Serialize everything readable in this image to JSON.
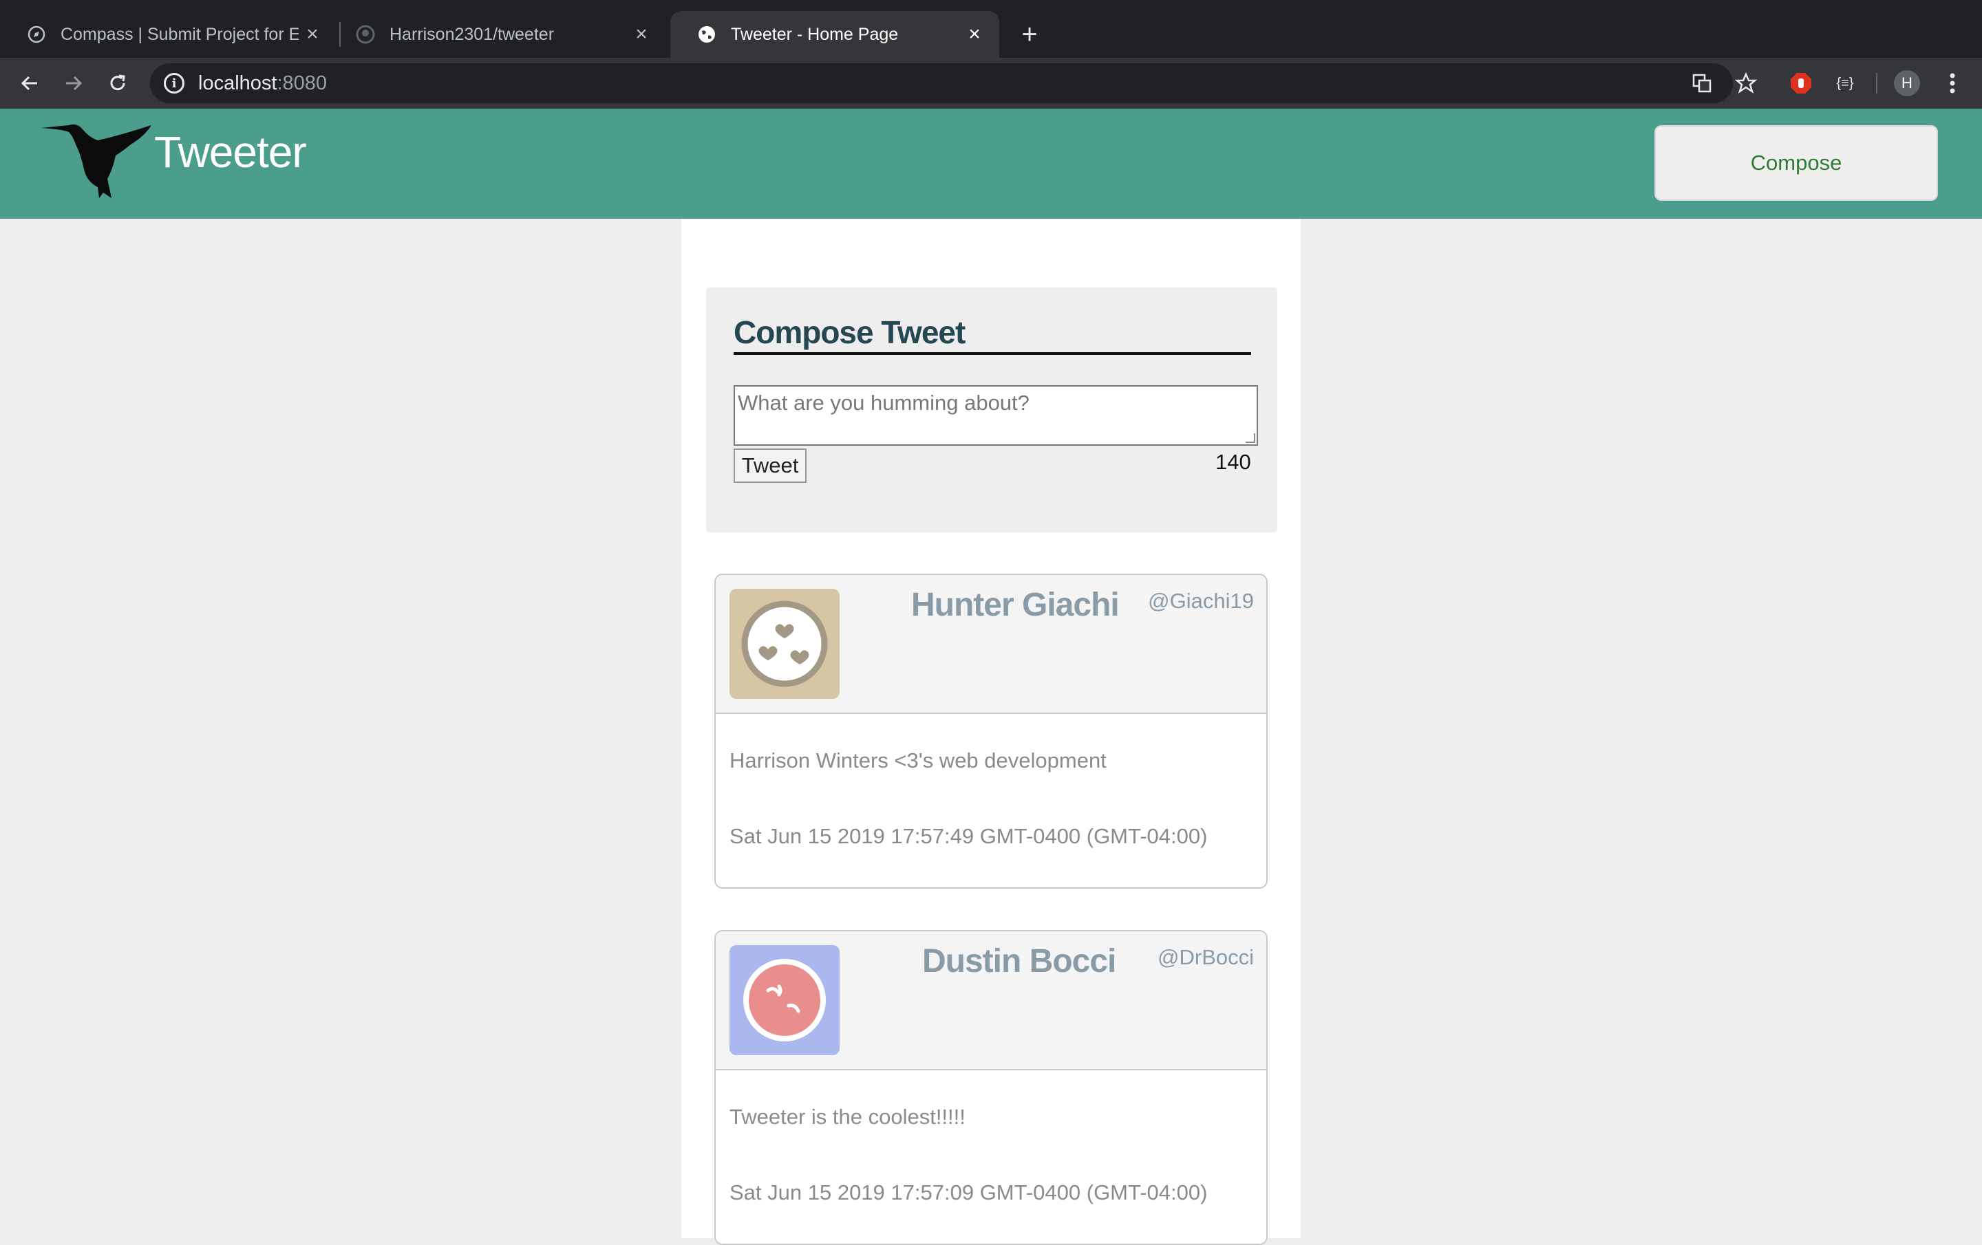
{
  "browser": {
    "tabs": [
      {
        "title": "Compass | Submit Project for E",
        "icon": "compass-icon"
      },
      {
        "title": "Harrison2301/tweeter",
        "icon": "github-icon"
      },
      {
        "title": "Tweeter - Home Page",
        "icon": "globe-icon"
      }
    ],
    "url_host": "localhost",
    "url_port": ":8080",
    "profile_initial": "H"
  },
  "app": {
    "brand": "Tweeter",
    "compose_button": "Compose"
  },
  "composer": {
    "title": "Compose Tweet",
    "placeholder": "What are you humming about?",
    "submit_label": "Tweet",
    "counter": "140"
  },
  "tweets": [
    {
      "name": "Hunter Giachi",
      "handle": "@Giachi19",
      "text": "Harrison Winters <3's web development",
      "date": "Sat Jun 15 2019 17:57:49 GMT-0400 (GMT-04:00)",
      "avatar_bg": "#d7c6a4",
      "avatar_fg": "#a39785"
    },
    {
      "name": "Dustin Bocci",
      "handle": "@DrBocci",
      "text": "Tweeter is the coolest!!!!!",
      "date": "Sat Jun 15 2019 17:57:09 GMT-0400 (GMT-04:00)",
      "avatar_bg": "#aab8ee",
      "avatar_fg": "#e98d8d"
    }
  ],
  "colors": {
    "header": "#4a9e8b",
    "compose_text": "#2e7d32",
    "title": "#244751"
  }
}
